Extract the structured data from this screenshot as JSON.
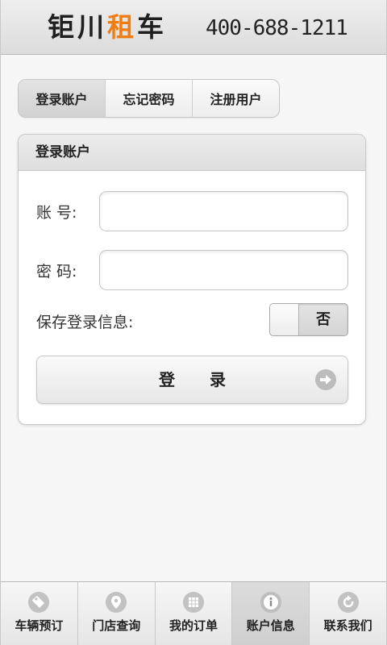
{
  "header": {
    "brand_part1": "钜川",
    "brand_accent": "租",
    "brand_part2": "车",
    "phone": "400-688-1211",
    "accent_color": "#ef7d16"
  },
  "tabs": [
    {
      "label": "登录账户",
      "active": true
    },
    {
      "label": "忘记密码",
      "active": false
    },
    {
      "label": "注册用户",
      "active": false
    }
  ],
  "login_card": {
    "title": "登录账户",
    "account_label": "账 号:",
    "account_value": "",
    "password_label": "密 码:",
    "password_value": "",
    "remember_label": "保存登录信息:",
    "remember_toggle": "否",
    "login_button": "登 录",
    "login_icon": "arrow-right-circle-icon"
  },
  "bottom_nav": [
    {
      "label": "车辆预订",
      "icon": "tag-icon",
      "active": false
    },
    {
      "label": "门店查询",
      "icon": "location-pin-icon",
      "active": false
    },
    {
      "label": "我的订单",
      "icon": "grid-icon",
      "active": false
    },
    {
      "label": "账户信息",
      "icon": "info-icon",
      "active": true
    },
    {
      "label": "联系我们",
      "icon": "refresh-arrow-icon",
      "active": false
    }
  ]
}
